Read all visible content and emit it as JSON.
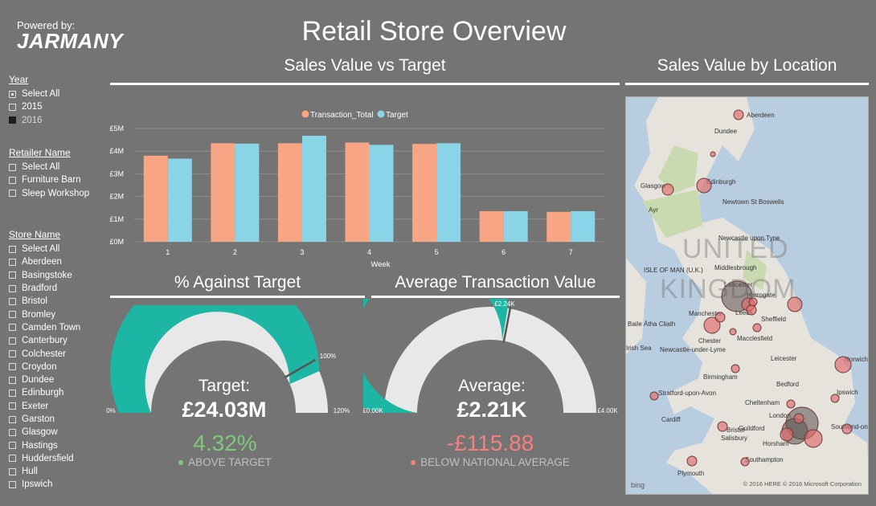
{
  "header": {
    "powered_by": "Powered by:",
    "brand": "JARMANY",
    "title": "Retail Store Overview"
  },
  "slicers": {
    "year": {
      "title": "Year",
      "items": [
        {
          "label": "Select All",
          "state": "partial"
        },
        {
          "label": "2015",
          "state": "off"
        },
        {
          "label": "2016",
          "state": "on"
        }
      ]
    },
    "retailer": {
      "title": "Retailer Name",
      "items": [
        {
          "label": "Select All",
          "state": "off"
        },
        {
          "label": "Furniture Barn",
          "state": "off"
        },
        {
          "label": "Sleep Workshop",
          "state": "off"
        }
      ]
    },
    "store": {
      "title": "Store Name",
      "items": [
        {
          "label": "Select All"
        },
        {
          "label": "Aberdeen"
        },
        {
          "label": "Basingstoke"
        },
        {
          "label": "Bradford"
        },
        {
          "label": "Bristol"
        },
        {
          "label": "Bromley"
        },
        {
          "label": "Camden Town"
        },
        {
          "label": "Canterbury"
        },
        {
          "label": "Colchester"
        },
        {
          "label": "Croydon"
        },
        {
          "label": "Dundee"
        },
        {
          "label": "Edinburgh"
        },
        {
          "label": "Exeter"
        },
        {
          "label": "Garston"
        },
        {
          "label": "Glasgow"
        },
        {
          "label": "Hastings"
        },
        {
          "label": "Huddersfield"
        },
        {
          "label": "Hull"
        },
        {
          "label": "Ipswich"
        }
      ]
    }
  },
  "sales_section": {
    "title": "Sales Value vs Target"
  },
  "map_section": {
    "title": "Sales Value by Location",
    "country_label_1": "UNITED",
    "country_label_2": "KINGDOM",
    "attribution": "© 2016 HERE   © 2016 Microsoft Corporation",
    "bing": "bing",
    "labels": [
      "Aberdeen",
      "Dundee",
      "Edinburgh",
      "Glasgow",
      "Newtown St Boswells",
      "Ayr",
      "Newcastle upon Tyne",
      "Middlesbrough",
      "ISLE OF MAN (U.K.)",
      "Lancaster",
      "Harrogate",
      "Leeds",
      "Manchester",
      "Sheffield",
      "Macclesfield",
      "Baile Átha Cliath",
      "Newcastle-under-Lyme",
      "Chester",
      "Leicester",
      "Birmingham",
      "Norwich",
      "Stratford-upon-Avon",
      "Bedford",
      "Cheltenham",
      "Ipswich",
      "Cardiff",
      "Bristol",
      "London",
      "Southend-on-Sea",
      "Guildford",
      "Salisbury",
      "Horsham",
      "Southampton",
      "Plymouth",
      "Irish Sea"
    ]
  },
  "chart_data": {
    "type": "bar",
    "categories": [
      "1",
      "2",
      "3",
      "4",
      "5",
      "6",
      "7"
    ],
    "series": [
      {
        "name": "Transaction_Total",
        "values": [
          3.8,
          4.35,
          4.35,
          4.38,
          4.32,
          1.35,
          1.32
        ],
        "color": "#f7a582"
      },
      {
        "name": "Target",
        "values": [
          3.67,
          4.33,
          4.68,
          4.28,
          4.35,
          1.35,
          1.35
        ],
        "color": "#8ad4e8"
      }
    ],
    "xlabel": "Week",
    "ylabel": "",
    "ylim": [
      0,
      5
    ],
    "ytick_labels": [
      "£0M",
      "£1M",
      "£2M",
      "£3M",
      "£4M",
      "£5M"
    ],
    "legend": "top-center",
    "grid": true
  },
  "gauges": {
    "against_target": {
      "title": "% Against Target",
      "label": "Target:",
      "value_text": "£24.03M",
      "fraction": 0.8694,
      "target_fraction": 0.8333,
      "target_label": "100%",
      "min_label": "0%",
      "max_label": "120%",
      "metric": "4.32%",
      "status": "ABOVE TARGET",
      "metric_color": "#7ec87a",
      "dot_color": "#7ec87a",
      "fill_color": "#1db6a4"
    },
    "avg_transaction": {
      "title": "Average Transaction Value",
      "label": "Average:",
      "value_text": "£2.21K",
      "fraction": 0.5525,
      "target_fraction": 0.56,
      "target_label": "£2.24K",
      "min_label": "£0.00K",
      "max_label": "£4.00K",
      "metric": "-£115.88",
      "status": "BELOW NATIONAL AVERAGE",
      "metric_color": "#f47f7f",
      "dot_color": "#f47f7f",
      "fill_color": "#1db6a4"
    }
  },
  "colors": {
    "background": "#747474",
    "bubble": "#e06a6a"
  }
}
